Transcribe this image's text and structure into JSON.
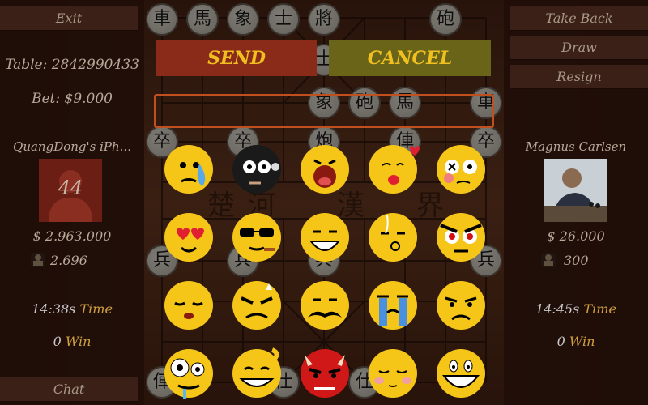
{
  "left_panel": {
    "exit_label": "Exit",
    "table_label": "Table: 2842990433",
    "bet_label": "Bet: $9.000",
    "player_name": "QuangDong's iPh...",
    "avatar_text": "44",
    "money": "$ 2.963.000",
    "score": "2.696",
    "time_value": "14:38s",
    "time_label": "Time",
    "win_value": "0",
    "win_label": "Win",
    "chat_label": "Chat"
  },
  "right_panel": {
    "take_back_label": "Take Back",
    "draw_label": "Draw",
    "resign_label": "Resign",
    "player_name": "Magnus Carlsen",
    "money": "$ 26.000",
    "score": "300",
    "time_value": "14:45s",
    "time_label": "Time",
    "win_value": "0",
    "win_label": "Win"
  },
  "chat": {
    "send_label": "SEND",
    "cancel_label": "CANCEL",
    "input_value": ""
  },
  "board": {
    "top_pieces": [
      "車",
      "馬",
      "象",
      "士",
      "將",
      "砲"
    ],
    "mid_pieces": [
      "士",
      "象",
      "砲",
      "馬",
      "車"
    ],
    "pawn_row": [
      "卒",
      "卒",
      "炮",
      "俥",
      "卒"
    ],
    "river_text": [
      "楚",
      "河",
      "漢",
      "界"
    ],
    "lower_pawns": [
      "兵",
      "兵",
      "兵",
      "兵"
    ],
    "bottom_pieces": [
      "俥",
      "仕",
      "仕"
    ]
  },
  "emojis": [
    "sweating",
    "black-puffing",
    "yawning",
    "kissing",
    "dizzy",
    "heart-eyes",
    "cool-sunglasses",
    "grinning",
    "whistling",
    "angry-red-eyes",
    "sleepy",
    "furious",
    "mustache-frown",
    "crying",
    "disappointed",
    "surprised-drooling",
    "mischievous",
    "devil-angry",
    "blushing-shy",
    "laughing"
  ],
  "colors": {
    "send_bg": "#8a2a18",
    "cancel_bg": "#6a6418",
    "button_text": "#f0c020",
    "input_border": "#c05020"
  }
}
